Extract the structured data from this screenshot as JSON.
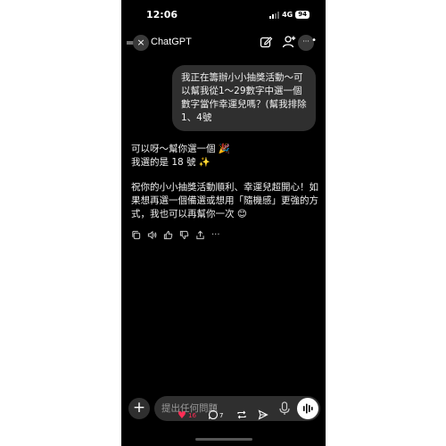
{
  "status_bar": {
    "time": "12:06",
    "network": "4G",
    "battery": "94"
  },
  "header": {
    "title": "ChatGPT",
    "menu_glyph": "═",
    "close_glyph": "×",
    "more_glyph": "···",
    "dot_glyph": "•"
  },
  "conversation": {
    "user_message": "我正在籌辦小小抽獎活動～可以幫我從1～29數字中選一個數字當作幸運兒嗎？(幫我排除1、4號",
    "assistant_lines": [
      "可以呀～幫你選一個 🎉",
      "我選的是 18 號 ✨",
      "祝你的小小抽獎活動順利、幸運兒超開心！如果想再選一個備選或想用「隨機感」更強的方式，我也可以再幫你一次 😊"
    ]
  },
  "actions": [
    "copy-icon",
    "speaker-icon",
    "thumbs-up-icon",
    "thumbs-down-icon",
    "share-icon",
    "more-icon"
  ],
  "actions_more_glyph": "···",
  "composer": {
    "plus_glyph": "+",
    "placeholder": "提出任何問題"
  },
  "social": {
    "heart_glyph": "♥",
    "likes": "16",
    "comments": "7"
  },
  "colors": {
    "background": "#000000",
    "bubble": "#2f2f2f",
    "heart": "#ff2d55"
  }
}
